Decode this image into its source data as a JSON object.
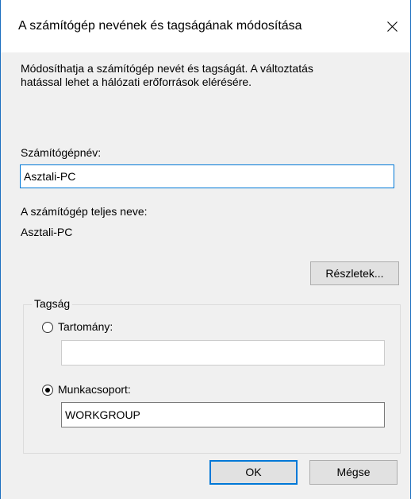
{
  "dialog": {
    "title": "A számítógép nevének és tagságának módosítása",
    "close_icon": "close-icon",
    "description": "Módosíthatja a számítógép nevét és tagságát. A változtatás\nhatással lehet a hálózati erőforrások elérésére.",
    "computer_name": {
      "label": "Számítógépnév:",
      "value": "Asztali-PC"
    },
    "full_name": {
      "label": "A számítógép teljes neve:",
      "value": "Asztali-PC"
    },
    "details_button": "Részletek...",
    "membership": {
      "legend": "Tagság",
      "domain": {
        "label": "Tartomány:",
        "selected": false,
        "value": ""
      },
      "workgroup": {
        "label": "Munkacsoport:",
        "selected": true,
        "value": "WORKGROUP"
      }
    },
    "ok_button": "OK",
    "cancel_button": "Mégse"
  }
}
